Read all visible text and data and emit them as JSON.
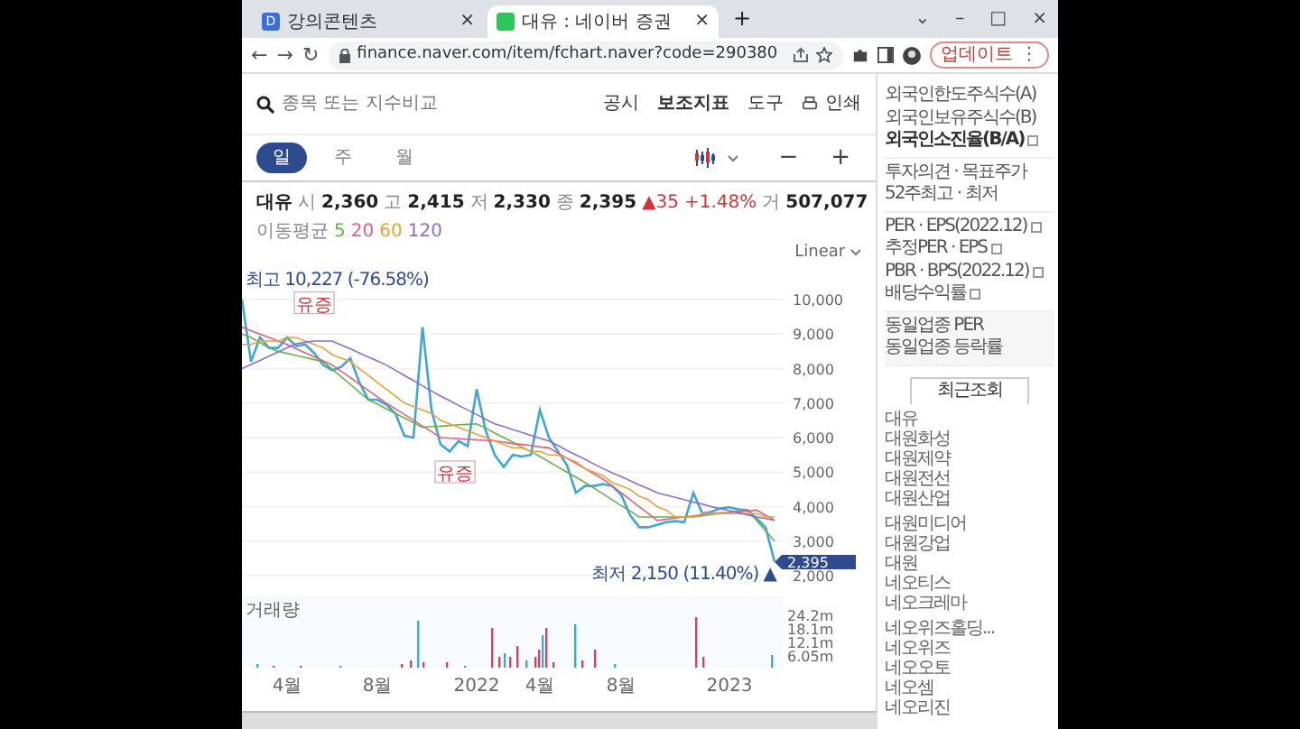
{
  "browser": {
    "tabs": [
      {
        "title": "강의콘텐츠",
        "icon_text": "D",
        "close": "×",
        "selected": false
      },
      {
        "title": "대유 : 네이버 증권",
        "close": "×",
        "selected": true
      }
    ],
    "new_tab": "+",
    "window_controls": [
      "⌄",
      "–",
      "□",
      "×"
    ],
    "nav": [
      "←",
      "→",
      "↻"
    ],
    "url": "finance.naver.com/item/fchart.naver?code=290380",
    "update_button": "업데이트",
    "menu": "⋮"
  },
  "toolbar": {
    "search_placeholder": "종목 또는 지수비교",
    "links": [
      {
        "label": "공시",
        "bold": false
      },
      {
        "label": "보조지표",
        "bold": true
      },
      {
        "label": "도구",
        "bold": false
      }
    ],
    "print": "인쇄"
  },
  "periods": [
    {
      "label": "일",
      "selected": true
    },
    {
      "label": "주",
      "selected": false
    },
    {
      "label": "월",
      "selected": false
    }
  ],
  "zoom_buttons": [
    "−",
    "+"
  ],
  "quote": {
    "name": "대유",
    "fields": [
      {
        "label": "시",
        "value": "2,360"
      },
      {
        "label": "고",
        "value": "2,415"
      },
      {
        "label": "저",
        "value": "2,330"
      },
      {
        "label": "종",
        "value": "2,395"
      }
    ],
    "change": "▲35",
    "change_pct": "+1.48%",
    "volume_label": "거",
    "volume": "507,077"
  },
  "moving_average_label": "이동평균",
  "scale": "Linear",
  "price_chart": {
    "high_label": "최고 10,227 (-76.58%)",
    "low_label": "최저 2,150 (11.40%) ▲",
    "current": "2,395",
    "markers": [
      "유증",
      "유증"
    ],
    "chart_data": {
      "type": "line",
      "ylim": [
        2000,
        10000
      ],
      "grid": true,
      "yticks": [
        {
          "value": 10000,
          "label": "10,000"
        },
        {
          "value": 9000,
          "label": "9,000"
        },
        {
          "value": 8000,
          "label": "8,000"
        },
        {
          "value": 7000,
          "label": "7,000"
        },
        {
          "value": 6000,
          "label": "6,000"
        },
        {
          "value": 5000,
          "label": "5,000"
        },
        {
          "value": 4000,
          "label": "4,000"
        },
        {
          "value": 3000,
          "label": "3,000"
        },
        {
          "value": 2000,
          "label": "2,000"
        }
      ],
      "series": [
        {
          "color": "#3fa7d6",
          "values": [
            10000,
            8200,
            8900,
            8600,
            8600,
            8900,
            8650,
            8700,
            8450,
            8100,
            7950,
            8050,
            8300,
            7600,
            7100,
            7100,
            6950,
            6700,
            6050,
            6000,
            9200,
            6800,
            5800,
            5600,
            5900,
            5750,
            7400,
            6200,
            5500,
            5150,
            5500,
            5450,
            5500,
            6800,
            6000,
            5600,
            5200,
            4400,
            4600,
            4600,
            4650,
            4600,
            4350,
            3750,
            3400,
            3400,
            3470,
            3550,
            3580,
            3550,
            4400,
            3800,
            3850,
            3950,
            3980,
            3920,
            3900,
            3650,
            3400,
            2400
          ]
        },
        {
          "name": "5",
          "color": "#6ab04c",
          "values": [
            9000,
            8900,
            8750,
            8600,
            8500,
            8440,
            8380,
            8320,
            8260,
            8200,
            7980,
            7760,
            7540,
            7320,
            7100,
            6970,
            6830,
            6700,
            6570,
            6430,
            6300,
            6320,
            6330,
            6350,
            6370,
            6380,
            6400,
            6270,
            6130,
            6000,
            5870,
            5730,
            5600,
            5450,
            5300,
            5150,
            5000,
            4850,
            4700,
            4530,
            4370,
            4200,
            4030,
            3870,
            3700,
            3700,
            3700,
            3700,
            3700,
            null,
            3700,
            3730,
            3770,
            3800,
            3830,
            3870,
            3900,
            3600,
            3300,
            3000
          ]
        },
        {
          "name": "20",
          "color": "#e0607e",
          "values": [
            9200,
            9100,
            9000,
            8900,
            8800,
            8700,
            8580,
            8460,
            8340,
            8220,
            8100,
            7920,
            7740,
            7550,
            7370,
            7180,
            7000,
            6830,
            6670,
            6500,
            6330,
            6170,
            6000,
            5980,
            5970,
            5950,
            5930,
            5920,
            5900,
            5870,
            5830,
            5800,
            5770,
            5730,
            5700,
            5550,
            5400,
            5250,
            5100,
            4950,
            4800,
            4600,
            4400,
            4200,
            4000,
            3800,
            3600,
            3630,
            3670,
            3700,
            3730,
            3770,
            3800,
            3820,
            3830,
            3850,
            3870,
            3900,
            3750,
            3600
          ]
        },
        {
          "name": "60",
          "color": "#e8a33d",
          "values": [
            8700,
            8700,
            8800,
            8800,
            8800,
            8900,
            8900,
            8800,
            8700,
            8600,
            8400,
            8300,
            8200,
            8000,
            7800,
            7600,
            7400,
            7200,
            7000,
            6900,
            6800,
            6700,
            6500,
            6400,
            6300,
            6200,
            6100,
            6000,
            5900,
            5800,
            5700,
            5700,
            5600,
            5600,
            5500,
            5500,
            5400,
            5300,
            5100,
            5000,
            4900,
            4700,
            4600,
            4500,
            4300,
            4200,
            4000,
            3900,
            3700,
            3700,
            3700,
            3800,
            3800,
            3800,
            3800,
            3800,
            3800,
            3800,
            3700,
            3700
          ]
        },
        {
          "name": "120",
          "color": "#8a6fd1",
          "values": [
            8000,
            8120,
            8240,
            8360,
            8480,
            8600,
            8720,
            8760,
            8800,
            8800,
            8800,
            8680,
            8570,
            8450,
            8330,
            8220,
            8100,
            7950,
            7800,
            7650,
            7500,
            7350,
            7200,
            7070,
            6930,
            6800,
            6670,
            6530,
            6400,
            6320,
            6230,
            6150,
            6070,
            5980,
            5900,
            5770,
            5630,
            5500,
            5370,
            5230,
            5100,
            4980,
            4870,
            4750,
            4630,
            4520,
            4400,
            4330,
            4270,
            4200,
            4130,
            4070,
            4000,
            3940,
            3880,
            3820,
            3760,
            3700,
            3650,
            3600
          ]
        }
      ]
    }
  },
  "volume_chart": {
    "title": "거래량",
    "ticks": [
      "24.2m",
      "18.1m",
      "12.1m",
      "6.05m"
    ]
  },
  "x_labels": [
    "4월",
    "8월",
    "2022",
    "4월",
    "8월",
    "2023"
  ],
  "sidebar": {
    "info_groups": [
      [
        {
          "label": "외국인한도주식수(A)",
          "bold": false,
          "icon": false
        },
        {
          "label": "외국인보유주식수(B)",
          "bold": false,
          "icon": false
        },
        {
          "label": "외국인소진율(B/A)",
          "bold": true,
          "icon": true
        }
      ],
      [
        {
          "label": "투자의견 · 목표주가",
          "bold": false,
          "icon": false
        },
        {
          "label": "52주최고 · 최저",
          "bold": false,
          "icon": false
        }
      ],
      [
        {
          "label": "PER · EPS(2022.12)",
          "bold": false,
          "icon": true
        },
        {
          "label": "추정PER · EPS",
          "bold": false,
          "icon": true
        },
        {
          "label": "PBR · BPS(2022.12)",
          "bold": false,
          "icon": true
        },
        {
          "label": "배당수익률",
          "bold": false,
          "icon": true
        }
      ],
      [
        {
          "label": "동일업종 PER",
          "bold": false,
          "icon": false
        },
        {
          "label": "동일업종 등락률",
          "bold": false,
          "icon": false
        }
      ]
    ],
    "recent_tab": "최근조회",
    "recent_groups": [
      [
        "대유",
        "대원화성",
        "대원제약",
        "대원전선",
        "대원산업"
      ],
      [
        "대원미디어",
        "대원강업",
        "대원",
        "네오티스",
        "네오크레마"
      ],
      [
        "네오위즈홀딩...",
        "네오위즈",
        "네오오토",
        "네오셈",
        "네오리진"
      ]
    ]
  }
}
